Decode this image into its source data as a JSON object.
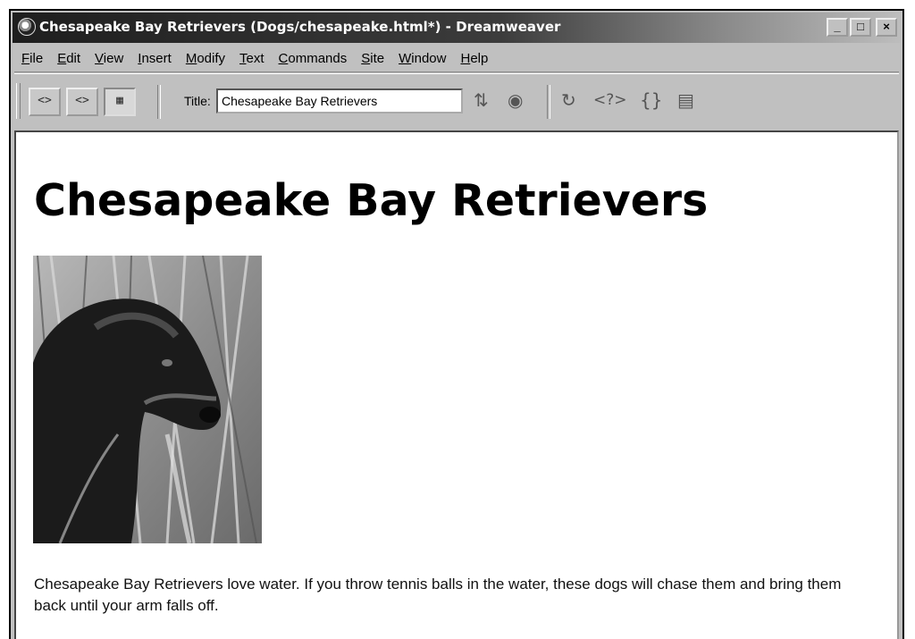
{
  "window": {
    "title": "Chesapeake Bay Retrievers (Dogs/chesapeake.html*) - Dreamweaver",
    "controls": {
      "minimize": "_",
      "maximize": "□",
      "close": "×"
    }
  },
  "menu": [
    {
      "pre": "",
      "key": "F",
      "rest": "ile"
    },
    {
      "pre": "",
      "key": "E",
      "rest": "dit"
    },
    {
      "pre": "",
      "key": "V",
      "rest": "iew"
    },
    {
      "pre": "",
      "key": "I",
      "rest": "nsert"
    },
    {
      "pre": "",
      "key": "M",
      "rest": "odify"
    },
    {
      "pre": "",
      "key": "T",
      "rest": "ext"
    },
    {
      "pre": "",
      "key": "C",
      "rest": "ommands"
    },
    {
      "pre": "",
      "key": "S",
      "rest": "ite"
    },
    {
      "pre": "",
      "key": "W",
      "rest": "indow"
    },
    {
      "pre": "",
      "key": "H",
      "rest": "elp"
    }
  ],
  "toolbar": {
    "code_view_icon": "<>",
    "split_view_icon": "<>",
    "design_view_icon": "▦",
    "title_label": "Title:",
    "title_value": "Chesapeake Bay Retrievers",
    "file_management_icon": "⇅",
    "preview_icon": "◉",
    "refresh_icon": "↻",
    "reference_icon": "<?>",
    "code_nav_icon": "{}",
    "view_options_icon": "▤"
  },
  "document": {
    "heading": "Chesapeake Bay Retrievers",
    "paragraph": "Chesapeake Bay Retrievers love water. If you throw tennis balls in the water, these dogs will chase them and bring them back until your arm falls off."
  }
}
